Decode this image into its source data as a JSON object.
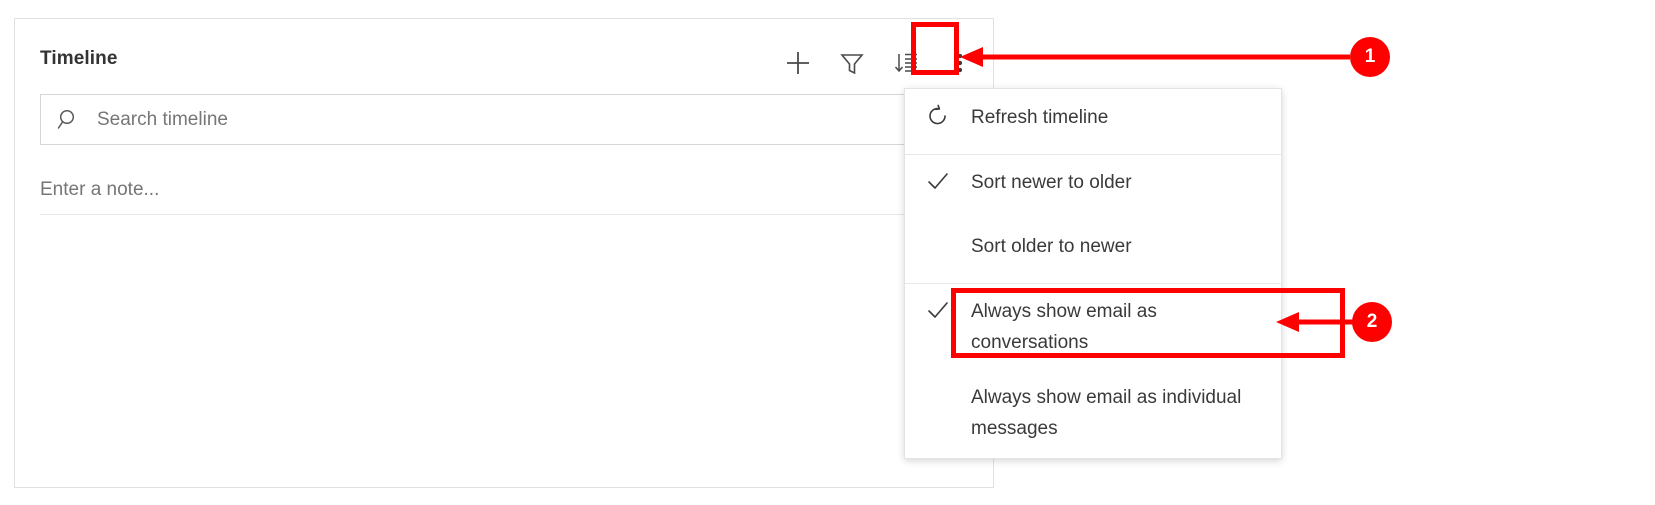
{
  "panel": {
    "title": "Timeline",
    "toolbar": [
      {
        "name": "add",
        "icon": "plus-icon",
        "label": "Add"
      },
      {
        "name": "filter",
        "icon": "funnel-icon",
        "label": "Filter"
      },
      {
        "name": "sort",
        "icon": "sort-descending-icon",
        "label": "Sort"
      },
      {
        "name": "more-commands",
        "icon": "more-vertical-icon",
        "label": "More commands"
      }
    ],
    "search": {
      "placeholder": "Search timeline",
      "value": "",
      "icon": "search-icon"
    },
    "note": {
      "placeholder": "Enter a note..."
    }
  },
  "menu": {
    "items": [
      {
        "label": "Refresh timeline",
        "icon": "refresh-icon",
        "checked": false
      },
      {
        "label": "Sort newer to older",
        "icon": "checkmark-icon",
        "checked": true
      },
      {
        "label": "Sort older to newer",
        "icon": "",
        "checked": false
      },
      {
        "label": "Always show email as conversations",
        "icon": "checkmark-icon",
        "checked": true
      },
      {
        "label": "Always show email as individual messages",
        "icon": "",
        "checked": false
      }
    ]
  },
  "annotations": {
    "accent_color": "#ff0000",
    "callouts": [
      {
        "number": "1",
        "target": "more-commands-button"
      },
      {
        "number": "2",
        "target": "always-show-email-as-conversations-item"
      }
    ]
  }
}
